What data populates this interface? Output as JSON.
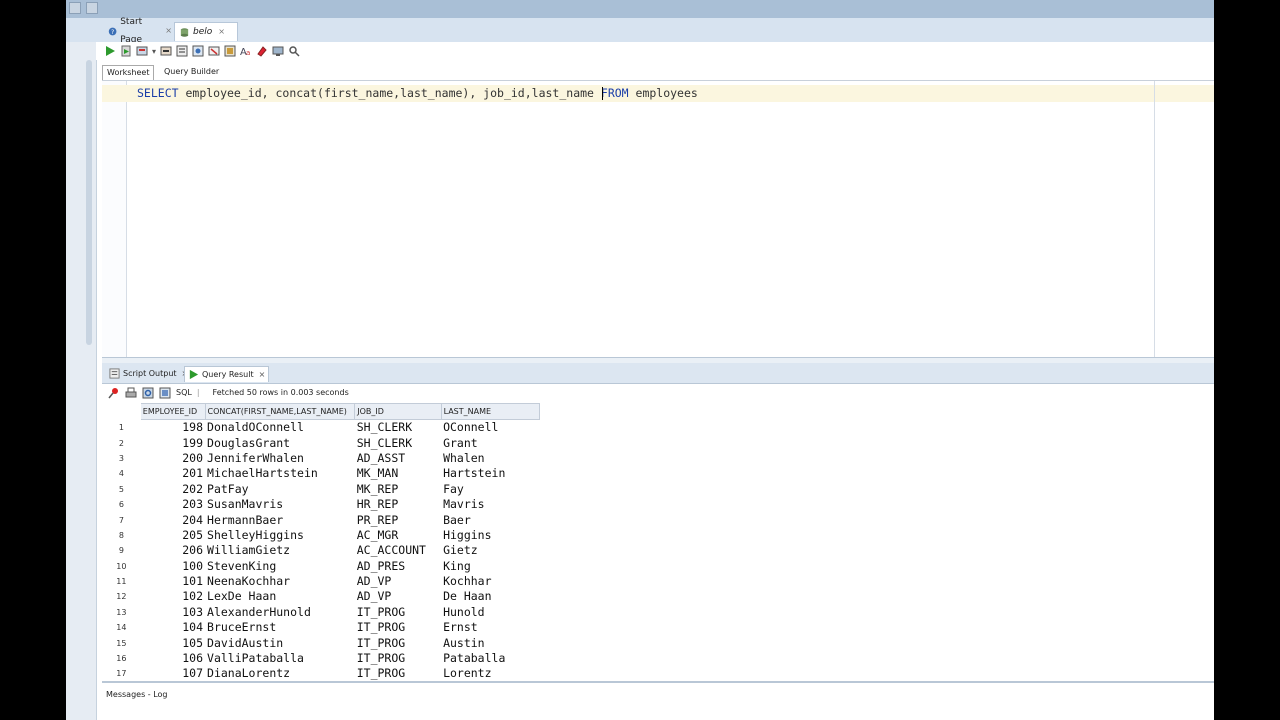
{
  "tabs": [
    {
      "label": "Start Page",
      "icon": "help-icon"
    },
    {
      "label": "belo",
      "icon": "database-icon"
    }
  ],
  "subtabs": {
    "worksheet": "Worksheet",
    "query_builder": "Query Builder"
  },
  "editor": {
    "sql_kw1": "SELECT",
    "sql_mid": " employee_id, concat(first_name,last_name), job_id,last_name ",
    "sql_kw2": "FROM",
    "sql_tail": " employees"
  },
  "results_tabs": [
    {
      "label": "Script Output"
    },
    {
      "label": "Query Result"
    }
  ],
  "results_toolbar": {
    "sql_label": "SQL",
    "status": "Fetched 50 rows in 0.003 seconds"
  },
  "grid": {
    "columns": [
      "EMPLOYEE_ID",
      "CONCAT(FIRST_NAME,LAST_NAME)",
      "JOB_ID",
      "LAST_NAME"
    ],
    "rows": [
      [
        "1",
        "198",
        "DonaldOConnell",
        "SH_CLERK",
        "OConnell"
      ],
      [
        "2",
        "199",
        "DouglasGrant",
        "SH_CLERK",
        "Grant"
      ],
      [
        "3",
        "200",
        "JenniferWhalen",
        "AD_ASST",
        "Whalen"
      ],
      [
        "4",
        "201",
        "MichaelHartstein",
        "MK_MAN",
        "Hartstein"
      ],
      [
        "5",
        "202",
        "PatFay",
        "MK_REP",
        "Fay"
      ],
      [
        "6",
        "203",
        "SusanMavris",
        "HR_REP",
        "Mavris"
      ],
      [
        "7",
        "204",
        "HermannBaer",
        "PR_REP",
        "Baer"
      ],
      [
        "8",
        "205",
        "ShelleyHiggins",
        "AC_MGR",
        "Higgins"
      ],
      [
        "9",
        "206",
        "WilliamGietz",
        "AC_ACCOUNT",
        "Gietz"
      ],
      [
        "10",
        "100",
        "StevenKing",
        "AD_PRES",
        "King"
      ],
      [
        "11",
        "101",
        "NeenaKochhar",
        "AD_VP",
        "Kochhar"
      ],
      [
        "12",
        "102",
        "LexDe Haan",
        "AD_VP",
        "De Haan"
      ],
      [
        "13",
        "103",
        "AlexanderHunold",
        "IT_PROG",
        "Hunold"
      ],
      [
        "14",
        "104",
        "BruceErnst",
        "IT_PROG",
        "Ernst"
      ],
      [
        "15",
        "105",
        "DavidAustin",
        "IT_PROG",
        "Austin"
      ],
      [
        "16",
        "106",
        "ValliPataballa",
        "IT_PROG",
        "Pataballa"
      ],
      [
        "17",
        "107",
        "DianaLorentz",
        "IT_PROG",
        "Lorentz"
      ]
    ]
  },
  "messages": {
    "label": "Messages - Log"
  }
}
